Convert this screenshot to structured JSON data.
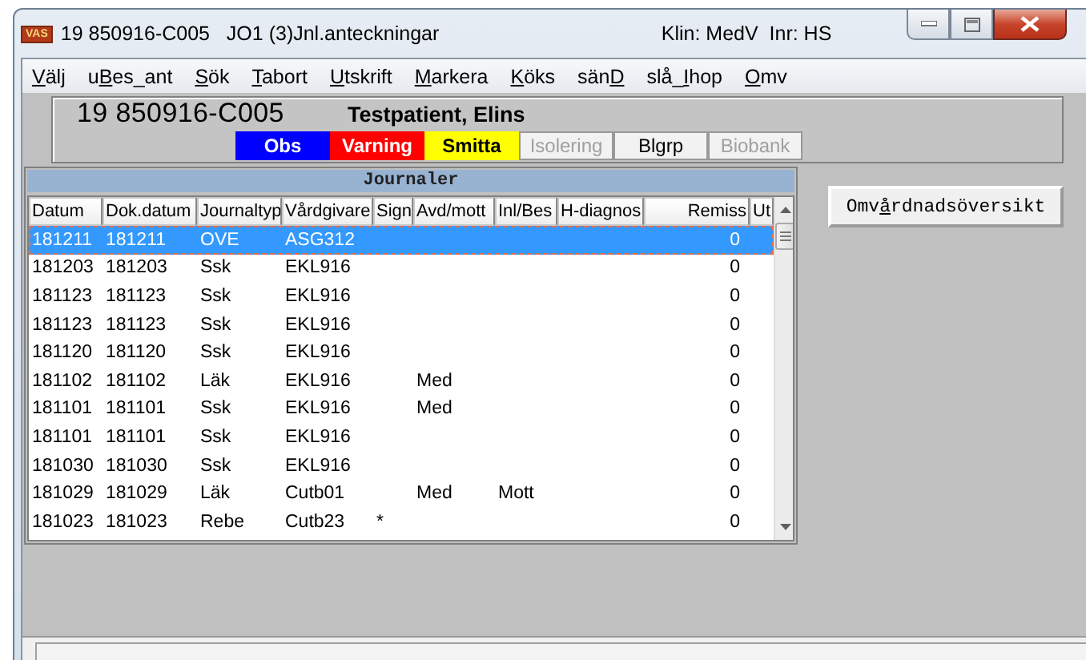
{
  "window": {
    "app_badge": "VAS",
    "title": "19 850916-C005   JO1 (3)Jnl.anteckningar",
    "info": "Klin: MedV  Inr: HS"
  },
  "menu": [
    {
      "key": "V",
      "post": "älj"
    },
    {
      "pre": "u",
      "key": "B",
      "post": "es_ant"
    },
    {
      "key": "S",
      "post": "ök"
    },
    {
      "key": "T",
      "post": "abort"
    },
    {
      "key": "U",
      "post": "tskrift"
    },
    {
      "key": "M",
      "post": "arkera"
    },
    {
      "key": "K",
      "post": "öks"
    },
    {
      "pre": "sän",
      "key": "D"
    },
    {
      "pre": "slå_",
      "key": "I",
      "post": "hop"
    },
    {
      "key": "O",
      "post": "mv"
    }
  ],
  "patient": {
    "id": "19 850916-C005",
    "name": "Testpatient, Elins"
  },
  "flags": [
    {
      "label": "Obs",
      "color": "#0000ff"
    },
    {
      "label": "Varning",
      "color": "#ff0000"
    },
    {
      "label": "Smitta",
      "color": "#ffff00"
    },
    {
      "label": "Isolering",
      "disabled": true
    },
    {
      "label": "Blgrp",
      "disabled": false
    },
    {
      "label": "Biobank",
      "disabled": true
    }
  ],
  "table": {
    "title": "Journaler",
    "columns": [
      "Datum",
      "Dok.datum",
      "Journaltyp",
      "Vårdgivare",
      "Sign",
      "Avd/mott",
      "Inl/Bes",
      "H-diagnos",
      "Remiss",
      "Ut"
    ],
    "rows": [
      {
        "selected": true,
        "datum": "181211",
        "dok_datum": "181211",
        "journaltyp": "OVE",
        "vardgivare": "ASG312",
        "remiss": "0"
      },
      {
        "selected": false,
        "datum": "181203",
        "dok_datum": "181203",
        "journaltyp": "Ssk",
        "vardgivare": "EKL916",
        "remiss": "0"
      },
      {
        "selected": false,
        "datum": "181123",
        "dok_datum": "181123",
        "journaltyp": "Ssk",
        "vardgivare": "EKL916",
        "remiss": "0"
      },
      {
        "selected": false,
        "datum": "181123",
        "dok_datum": "181123",
        "journaltyp": "Ssk",
        "vardgivare": "EKL916",
        "remiss": "0"
      },
      {
        "selected": false,
        "datum": "181120",
        "dok_datum": "181120",
        "journaltyp": "Ssk",
        "vardgivare": "EKL916",
        "remiss": "0"
      },
      {
        "selected": false,
        "datum": "181102",
        "dok_datum": "181102",
        "journaltyp": "Läk",
        "vardgivare": "EKL916",
        "avd_mott": "Med",
        "remiss": "0"
      },
      {
        "selected": false,
        "datum": "181101",
        "dok_datum": "181101",
        "journaltyp": "Ssk",
        "vardgivare": "EKL916",
        "avd_mott": "Med",
        "remiss": "0"
      },
      {
        "selected": false,
        "datum": "181101",
        "dok_datum": "181101",
        "journaltyp": "Ssk",
        "vardgivare": "EKL916",
        "remiss": "0"
      },
      {
        "selected": false,
        "datum": "181030",
        "dok_datum": "181030",
        "journaltyp": "Ssk",
        "vardgivare": "EKL916",
        "remiss": "0"
      },
      {
        "selected": false,
        "datum": "181029",
        "dok_datum": "181029",
        "journaltyp": "Läk",
        "vardgivare": "Cutb01",
        "avd_mott": "Med",
        "inl_bes": "Mott",
        "remiss": "0"
      },
      {
        "selected": false,
        "datum": "181023",
        "dok_datum": "181023",
        "journaltyp": "Rebe",
        "vardgivare": "Cutb23",
        "sign": "*",
        "remiss": "0"
      }
    ]
  },
  "side_button": {
    "pre": "Omv",
    "key": "å",
    "post": "rdnadsöversikt"
  }
}
